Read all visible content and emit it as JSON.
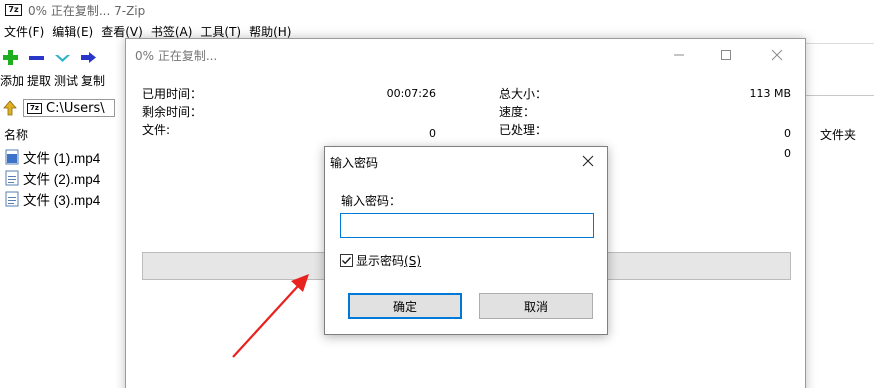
{
  "main_window": {
    "logo_text": "7z",
    "title": "0% 正在复制... 7-Zip",
    "menu": [
      "文件(F)",
      "编辑(E)",
      "查看(V)",
      "书签(A)",
      "工具(T)",
      "帮助(H)"
    ],
    "toolbar_icons": [
      "add-icon",
      "extract-icon",
      "test-icon",
      "copy-icon"
    ],
    "toolbar_labels": [
      "添加",
      "提取",
      "测试",
      "复制"
    ],
    "address_path": "C:\\Users\\",
    "columns": {
      "name": "名称",
      "folder": "文件夹"
    },
    "files": [
      {
        "name": "文件 (1).mp4",
        "icon": "video-file-icon"
      },
      {
        "name": "文件 (2).mp4",
        "icon": "video-file-icon"
      },
      {
        "name": "文件 (3).mp4",
        "icon": "video-file-icon"
      }
    ]
  },
  "progress_window": {
    "title": "0% 正在复制...",
    "elapsed_label": "已用时间：",
    "elapsed_value": "00:07:26",
    "remaining_label": "剩余时间：",
    "files_label": "文件:",
    "files_value": "0",
    "total_size_label": "总大小：",
    "total_size_value": "113 MB",
    "speed_label": "速度：",
    "processed_label": "已处理：",
    "processed_value": "0",
    "compressed_value": "0",
    "progress_percent": 0
  },
  "password_dialog": {
    "title": "输入密码",
    "label": "输入密码：",
    "value": "",
    "show_password_label": "显示密码",
    "show_password_shortcut": "(S)",
    "show_password_checked": true,
    "ok_label": "确定",
    "cancel_label": "取消"
  },
  "colors": {
    "accent": "#0078d7",
    "annotation_arrow": "#e8231f"
  }
}
